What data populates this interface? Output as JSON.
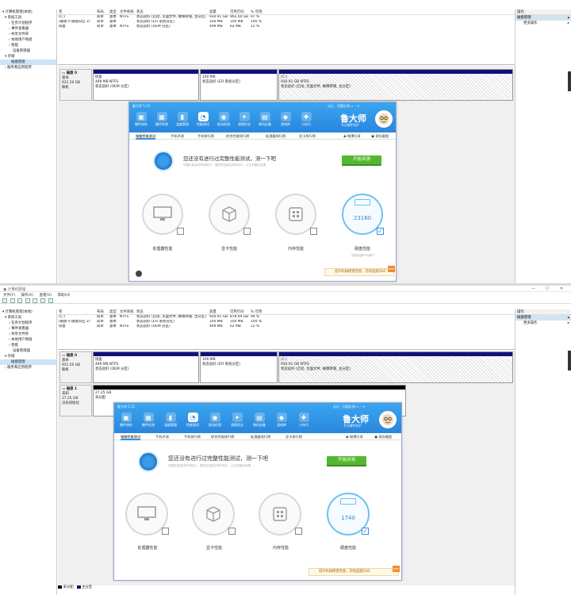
{
  "mmc": {
    "title": "计算机管理",
    "menu": [
      "文件(F)",
      "操作(A)",
      "查看(V)",
      "帮助(H)"
    ],
    "tree": [
      "计算机管理(本地)",
      "系统工具",
      "任务计划程序",
      "事件查看器",
      "共享文件夹",
      "本地用户和组",
      "性能",
      "设备管理器",
      "存储",
      "磁盘管理",
      "服务和应用程序"
    ],
    "volume_headers": [
      "卷",
      "布局",
      "类型",
      "文件系统",
      "状态",
      "容量",
      "可用空间",
      "% 可用"
    ],
    "volumes_top": [
      [
        "(C:)",
        "简单",
        "基本",
        "NTFS",
        "状态良好 (启动, 页面文件, 故障转储, 主分区)",
        "930.91 GB",
        "902.04 GB",
        "97 %"
      ],
      [
        "(磁盘 0 磁盘分区 2)",
        "简单",
        "基本",
        "",
        "状态良好 (EFI 系统分区)",
        "100 MB",
        "100 MB",
        "100 %"
      ],
      [
        "恢复",
        "简单",
        "基本",
        "NTFS",
        "状态良好 (OEM 分区)",
        "499 MB",
        "62 MB",
        "12 %"
      ]
    ],
    "volumes_bottom": [
      [
        "(C:)",
        "简单",
        "基本",
        "NTFS",
        "状态良好 (启动, 页面文件, 故障转储, 主分区)",
        "930.91 GB",
        "878.49 GB",
        "94 %"
      ],
      [
        "(磁盘 0 磁盘分区 2)",
        "简单",
        "基本",
        "",
        "状态良好 (EFI 系统分区)",
        "100 MB",
        "100 MB",
        "100 %"
      ],
      [
        "恢复",
        "简单",
        "基本",
        "NTFS",
        "状态良好 (OEM 分区)",
        "499 MB",
        "62 MB",
        "12 %"
      ]
    ],
    "actions_header": "操作",
    "actions_selected": "磁盘管理",
    "actions_more": "更多操作",
    "disk0": {
      "name": "磁盘 0",
      "type": "基本",
      "size": "931.50 GB",
      "status": "联机",
      "parts": [
        {
          "name": "恢复",
          "size": "499 MB NTFS",
          "state": "状态良好 (OEM 分区)"
        },
        {
          "name": "",
          "size": "100 MB",
          "state": "状态良好 (EFI 系统分区)"
        },
        {
          "name": "(C:)",
          "size": "930.91 GB NTFS",
          "state": "状态良好 (启动, 页面文件, 故障转储, 主分区)"
        }
      ]
    },
    "disk1": {
      "name": "磁盘 1",
      "type": "未知",
      "size": "27.25 GB",
      "status": "没有初始化",
      "part_size": "27.25 GB",
      "part_state": "未分配"
    },
    "legend": [
      "未分配",
      "主分区"
    ]
  },
  "ludashi": {
    "version": "鲁大师 5.15",
    "top_links": [
      "论坛",
      "问题反馈"
    ],
    "nav": [
      "硬件体检",
      "硬件检测",
      "温度管理",
      "性能测试",
      "驱动检测",
      "清理优化",
      "装机必备",
      "游戏库",
      "小技巧"
    ],
    "brand": "鲁大师",
    "brand_sub": "专注硬件防护",
    "tabs": [
      "电脑性能测试",
      "手机评测",
      "手机排行榜",
      "综合性能排行榜",
      "处理器排行榜",
      "显卡排行榜"
    ],
    "share": "微博分享",
    "save": "保存截图",
    "message": "您还没有进行过完整性能测试，测一下吧",
    "submessage": "完整性能测试时间较长，请您在电脑空闲时进行，以达到最佳效果",
    "start": "开始评测",
    "categories": [
      "处理器性能",
      "显卡性能",
      "内存性能",
      "硬盘性能"
    ],
    "score_top": "23160",
    "score_bottom": "1740",
    "disk_note": "击败全国97%用户",
    "ssd": "提升机械硬盘性能，轻松超越SSD",
    "new": "NEW"
  },
  "colors": {
    "accent": "#2a86dc",
    "start": "#53b82f",
    "disk_header": "#10107a"
  }
}
